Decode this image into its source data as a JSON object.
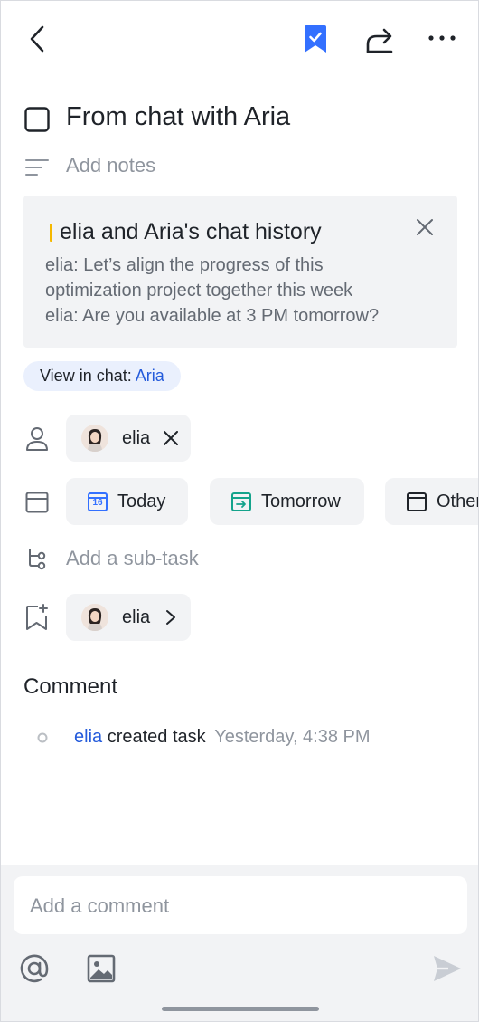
{
  "header": {
    "back_icon": "chevron-left-icon",
    "bookmark_icon": "bookmark-check-icon",
    "share_icon": "share-icon",
    "more_icon": "more-icon",
    "accent": "#3370ff"
  },
  "task": {
    "title": "From chat with Aria",
    "notes_placeholder": "Add notes"
  },
  "chat_card": {
    "title": "elia and Aria's chat history",
    "lines": [
      "elia: Let’s align the progress of this",
      "optimization project together this week",
      "elia: Are you available at 3 PM tomorrow?"
    ],
    "bar_color": "#f5b800"
  },
  "view_in_chat": {
    "label": "View in chat: ",
    "name": "Aria"
  },
  "assignee": {
    "name": "elia"
  },
  "due": {
    "today": "Today",
    "today_day": "16",
    "tomorrow": "Tomorrow",
    "other": "Other"
  },
  "subtask": {
    "placeholder": "Add a sub-task"
  },
  "follower": {
    "name": "elia"
  },
  "comments": {
    "heading": "Comment",
    "activity": {
      "user": "elia",
      "action": "created task",
      "time": "Yesterday, 4:38 PM"
    }
  },
  "composer": {
    "placeholder": "Add a comment",
    "mention_icon": "at-icon",
    "image_icon": "image-icon",
    "send_icon": "send-icon"
  }
}
